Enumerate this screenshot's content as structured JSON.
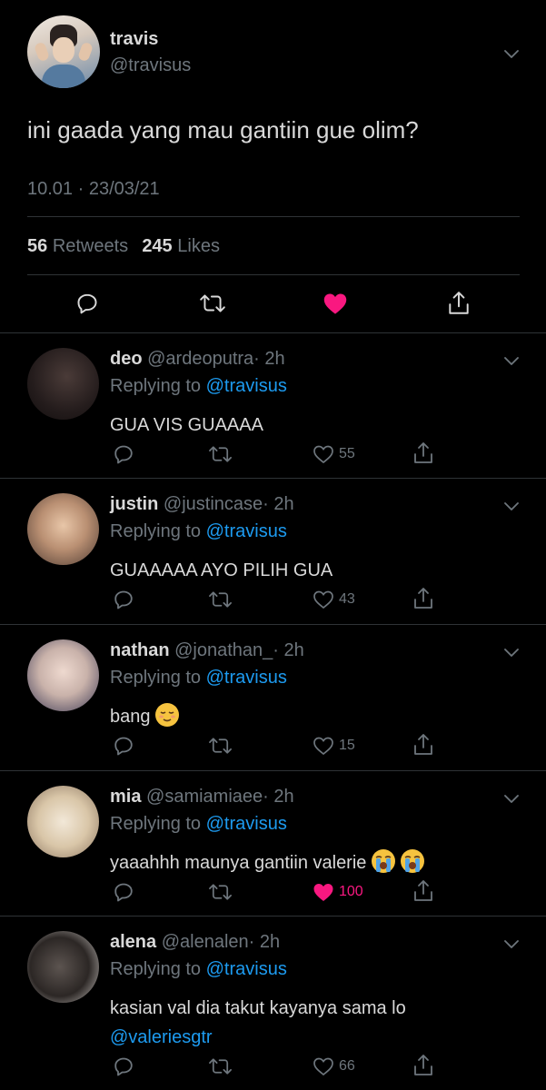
{
  "main_tweet": {
    "display_name": "travis",
    "handle": "@travisus",
    "text": "ini gaada yang mau gantiin gue olim?",
    "timestamp": "10.01 · 23/03/21",
    "retweets_count": "56",
    "retweets_label": "Retweets",
    "likes_count": "245",
    "likes_label": "Likes",
    "liked": true,
    "like_color": "#f91880"
  },
  "replies": [
    {
      "name": "deo",
      "handle": "@ardeoputra",
      "time": "· 2h",
      "replying_label": "Replying to",
      "replying_to": "@travisus",
      "text": "GUA VIS GUAAAA",
      "likes": "55",
      "liked": false
    },
    {
      "name": "justin",
      "handle": "@justincase",
      "time": "· 2h",
      "replying_label": "Replying to",
      "replying_to": "@travisus",
      "text": "GUAAAAA AYO PILIH GUA",
      "likes": "43",
      "liked": false
    },
    {
      "name": "nathan",
      "handle": "@jonathan_",
      "time": "· 2h",
      "replying_label": "Replying to",
      "replying_to": "@travisus",
      "text": "bang",
      "emoji": "relieved-face-emoji",
      "likes": "15",
      "liked": false
    },
    {
      "name": "mia",
      "handle": "@samiamiaee",
      "time": "· 2h",
      "replying_label": "Replying to",
      "replying_to": "@travisus",
      "text": "yaaahhh maunya gantiin valerie",
      "emoji": "loudly-crying-face-emoji",
      "likes": "100",
      "liked": true
    },
    {
      "name": "alena",
      "handle": "@alenalen",
      "time": "· 2h",
      "replying_label": "Replying to",
      "replying_to": "@travisus",
      "text": "kasian val dia takut kayanya sama lo",
      "mention": "@valeriesgtr",
      "likes": "66",
      "liked": false
    }
  ],
  "colors": {
    "background": "#000000",
    "text": "#d9d9d9",
    "muted": "#6e767d",
    "link": "#1d9bf0",
    "liked": "#f91880",
    "divider": "#2f3336"
  }
}
